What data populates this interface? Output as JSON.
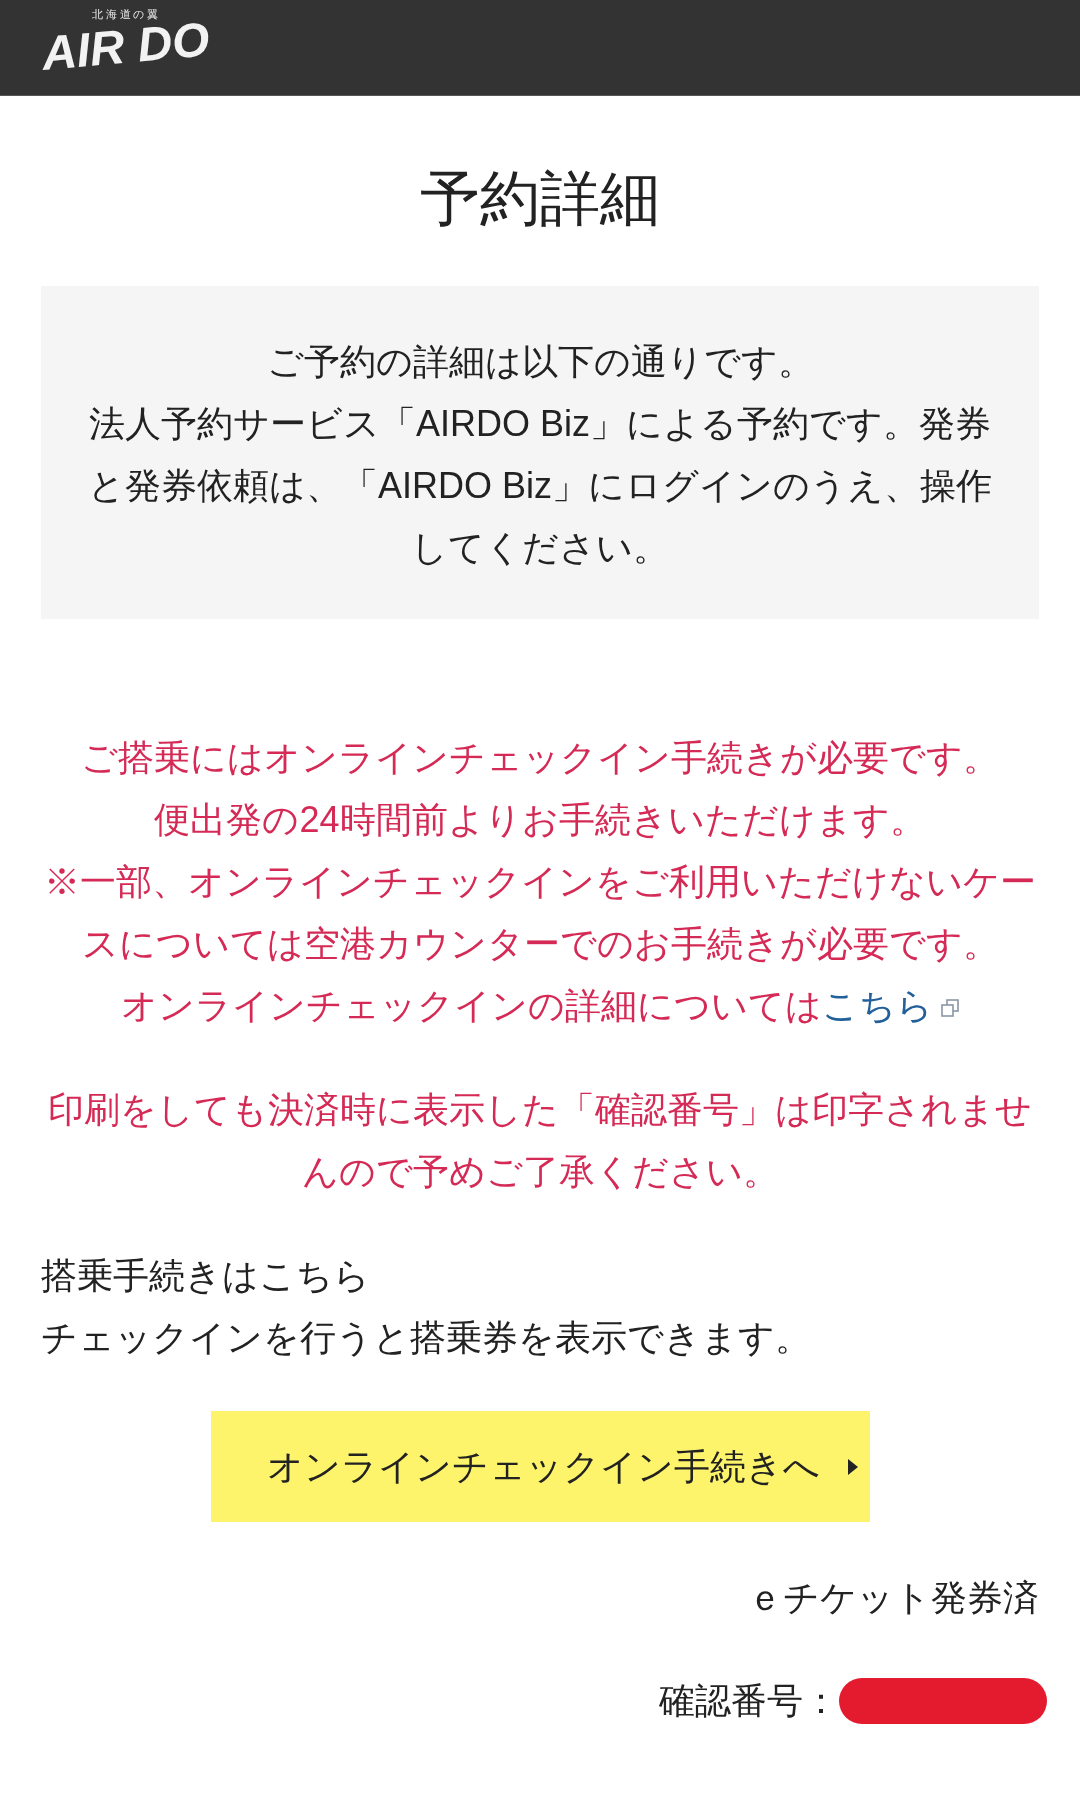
{
  "header": {
    "logo_tagline": "北海道の翼",
    "logo": "AIR DO"
  },
  "title": "予約詳細",
  "summary": {
    "lines": [
      "ご予約の詳細は以下の通りです。",
      "法人予約サービス「AIRDO Biz」による予約です。発券と発券依頼は、「AIRDO Biz」にログインのうえ、操作してください。"
    ]
  },
  "notice": {
    "lines": [
      "ご搭乗にはオンラインチェックイン手続きが必要です。",
      "便出発の24時間前よりお手続きいただけます。",
      "※一部、オンラインチェックインをご利用いただけないケースについては空港カウンターでのお手続きが必要です。"
    ],
    "link_sentence": {
      "text": "オンラインチェックインの詳細については",
      "link": "こちら"
    }
  },
  "print_notice": "印刷をしても決済時に表示した「確認番号」は印字されませんので予めご了承ください。",
  "checkin": {
    "heading": "搭乗手続きはこちら",
    "description": "チェックインを行うと搭乗券を表示できます。",
    "button": "オンラインチェックイン手続きへ"
  },
  "ticket_status": "ｅチケット発券済",
  "confirmation": {
    "label": "確認番号："
  }
}
